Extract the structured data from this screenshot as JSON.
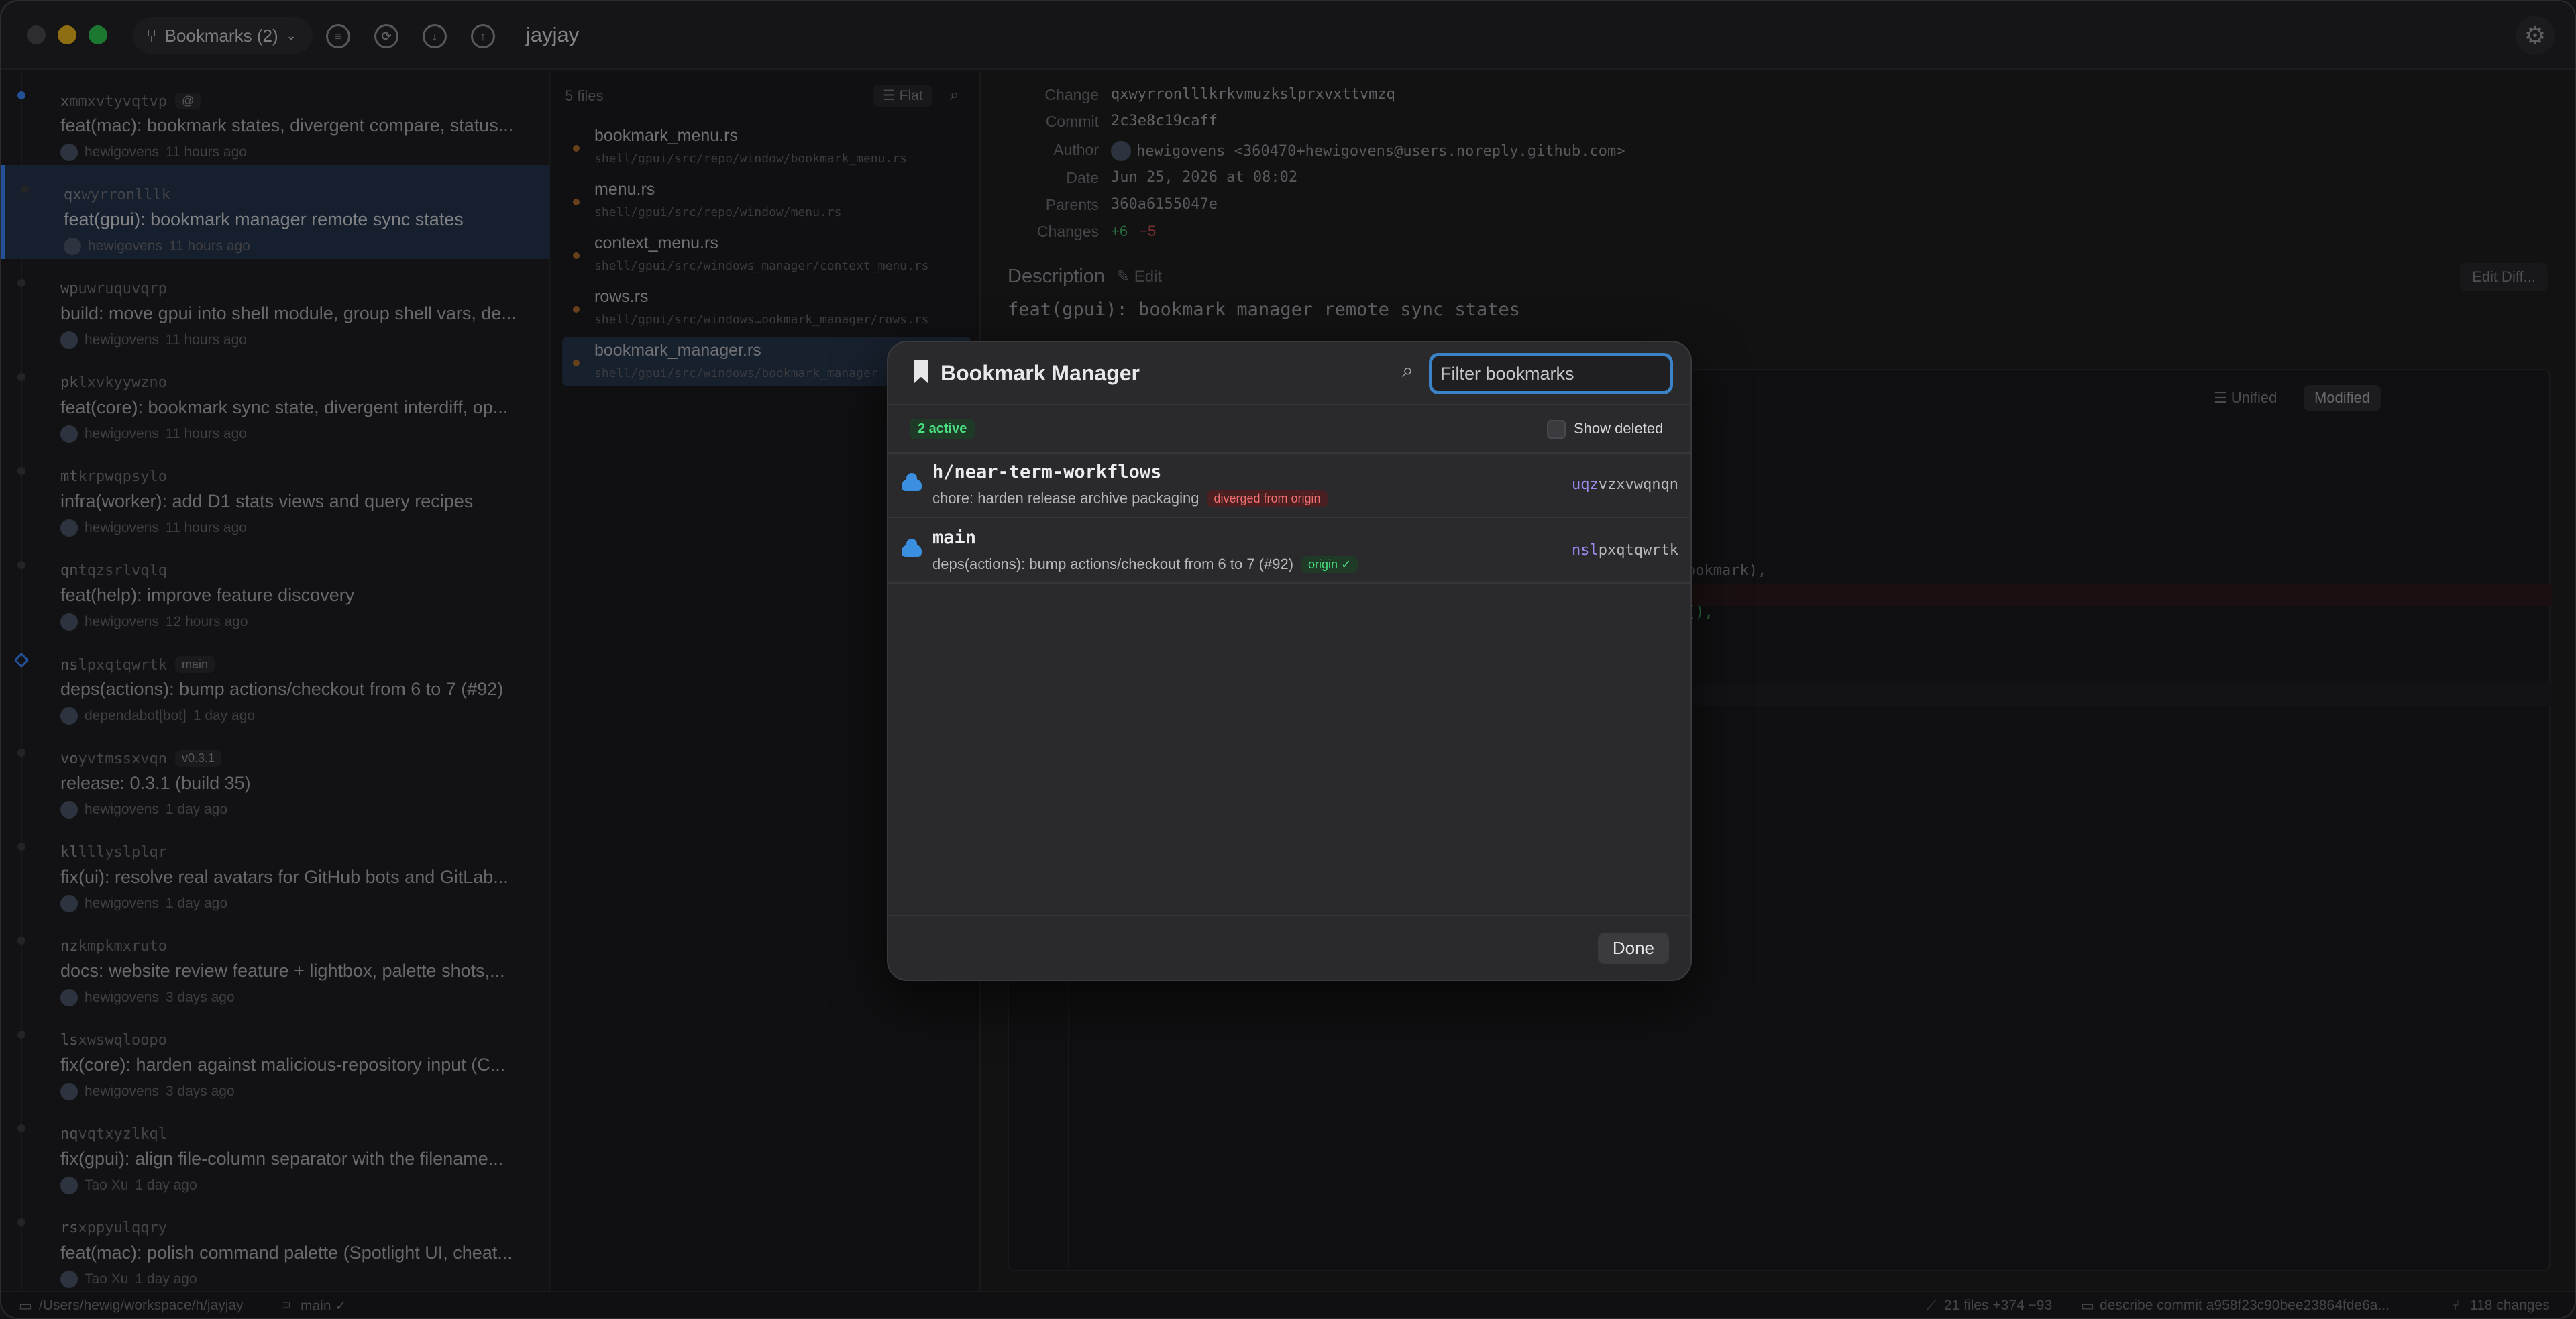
{
  "window": {
    "bookmarks_label": "Bookmarks (2)",
    "repo_title": "jayjay"
  },
  "commits": [
    {
      "prefix": "x",
      "rest": "mmxvtyvqtvp",
      "tag": "@",
      "message": "feat(mac): bookmark states, divergent compare, status...",
      "author": "hewigovens",
      "time": "11 hours ago"
    },
    {
      "prefix": "qx",
      "rest": "wyrronlllk",
      "tag": "",
      "message": "feat(gpui): bookmark manager remote sync states",
      "author": "hewigovens",
      "time": "11 hours ago"
    },
    {
      "prefix": "wp",
      "rest": "uwruquvqrp",
      "tag": "",
      "message": "build: move gpui into shell module, group shell vars, de...",
      "author": "hewigovens",
      "time": "11 hours ago"
    },
    {
      "prefix": "pk",
      "rest": "lxvkyywzno",
      "tag": "",
      "message": "feat(core): bookmark sync state, divergent interdiff, op...",
      "author": "hewigovens",
      "time": "11 hours ago"
    },
    {
      "prefix": "mt",
      "rest": "krpwqpsylo",
      "tag": "",
      "message": "infra(worker): add D1 stats views and query recipes",
      "author": "hewigovens",
      "time": "11 hours ago"
    },
    {
      "prefix": "qn",
      "rest": "tqzsrlvqlq",
      "tag": "",
      "message": "feat(help): improve feature discovery",
      "author": "hewigovens",
      "time": "12 hours ago"
    },
    {
      "prefix": "ns",
      "rest": "lpxqtqwrtk",
      "tag": "main",
      "message": "deps(actions): bump actions/checkout from 6 to 7 (#92)",
      "author": "dependabot[bot]",
      "time": "1 day ago"
    },
    {
      "prefix": "vo",
      "rest": "yvtmssxvqn",
      "tag": "v0.3.1",
      "message": "release: 0.3.1 (build 35)",
      "author": "hewigovens",
      "time": "1 day ago"
    },
    {
      "prefix": "kl",
      "rest": "lllyslplqr",
      "tag": "",
      "message": "fix(ui): resolve real avatars for GitHub bots and GitLab...",
      "author": "hewigovens",
      "time": "1 day ago"
    },
    {
      "prefix": "nz",
      "rest": "kmpkmxruto",
      "tag": "",
      "message": "docs: website review feature + lightbox, palette shots,...",
      "author": "hewigovens",
      "time": "3 days ago"
    },
    {
      "prefix": "ls",
      "rest": "xwswqloopo",
      "tag": "",
      "message": "fix(core): harden against malicious-repository input (C...",
      "author": "hewigovens",
      "time": "3 days ago"
    },
    {
      "prefix": "nq",
      "rest": "vqtxyzlkql",
      "tag": "",
      "message": "fix(gpui): align file-column separator with the filename...",
      "author": "Tao Xu",
      "time": "1 day ago"
    },
    {
      "prefix": "rs",
      "rest": "xppyulqqry",
      "tag": "",
      "message": "feat(mac): polish command palette (Spotlight UI, cheat...",
      "author": "Tao Xu",
      "time": "1 day ago"
    }
  ],
  "files": {
    "count_label": "5 files",
    "view_label": "Flat",
    "items": [
      {
        "name": "bookmark_menu.rs",
        "path": "shell/gpui/src/repo/window/bookmark_menu.rs"
      },
      {
        "name": "menu.rs",
        "path": "shell/gpui/src/repo/window/menu.rs"
      },
      {
        "name": "context_menu.rs",
        "path": "shell/gpui/src/windows_manager/context_menu.rs"
      },
      {
        "name": "rows.rs",
        "path": "shell/gpui/src/windows…ookmark_manager/rows.rs"
      },
      {
        "name": "bookmark_manager.rs",
        "path": "shell/gpui/src/windows/bookmark_manager"
      }
    ]
  },
  "detail": {
    "change_label": "Change",
    "change_value": "qxwyrronlllkrkvmuzkslprxvxttvmzq",
    "commit_label": "Commit",
    "commit_value": "2c3e8c19caff",
    "author_label": "Author",
    "author_value": "hewigovens <360470+hewigovens@users.noreply.github.com>",
    "date_label": "Date",
    "date_value": "Jun 25, 2026 at 08:02",
    "parents_label": "Parents",
    "parents_value": "360a6155047e",
    "changes_label": "Changes",
    "changes_add": "+6",
    "changes_del": "−5",
    "description_label": "Description",
    "edit_label": "Edit",
    "description": "feat(gpui): bookmark manager remote sync states",
    "edit_diff_label": "Edit Diff...",
    "unified_label": "Unified",
    "modified_label": "Modified",
    "diff_fragment_1": "ookmark),",
    "diff_fragment_2": "(),"
  },
  "status": {
    "path": "/Users/hewig/workspace/h/jayjay",
    "branch": "main ✓",
    "diffstat": "21 files +374 −93",
    "describe": "describe commit a958f23c90bee23864fde6a...",
    "changes": "118 changes"
  },
  "modal": {
    "title": "Bookmark Manager",
    "filter_placeholder": "Filter bookmarks",
    "active_label": "2 active",
    "show_deleted_label": "Show deleted",
    "done_label": "Done",
    "bookmarks": [
      {
        "name": "h/near-term-workflows",
        "desc": "chore: harden release archive packaging",
        "badge": "diverged from origin",
        "badge_kind": "red",
        "change_prefix": "uqz",
        "change_rest": "vzxvwqnqn"
      },
      {
        "name": "main",
        "desc": "deps(actions): bump actions/checkout from 6 to 7 (#92)",
        "badge": "origin ✓",
        "badge_kind": "green",
        "change_prefix": "nsl",
        "change_rest": "pxqtqwrtk"
      }
    ]
  },
  "colors": {
    "accent": "#3b82f6",
    "filter_focus": "#3b82c6",
    "diverged": "#f07070",
    "synced": "#4ade80"
  }
}
